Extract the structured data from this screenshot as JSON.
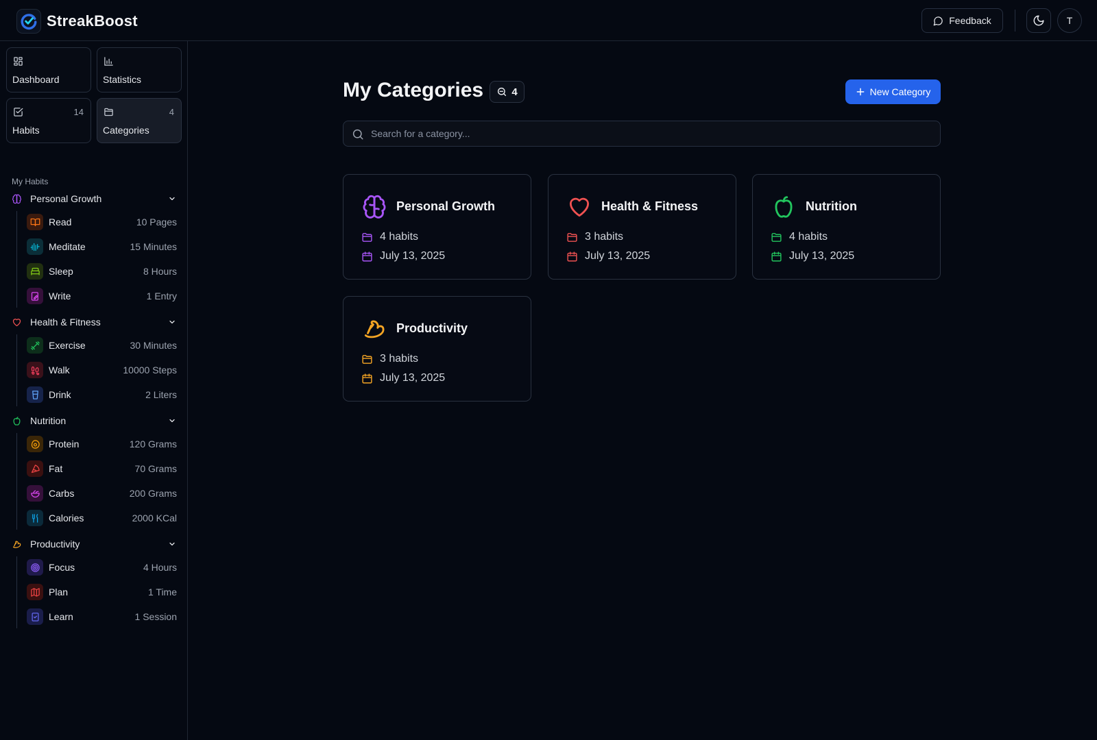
{
  "app": {
    "name": "StreakBoost"
  },
  "header": {
    "feedback_label": "Feedback",
    "avatar_initial": "T"
  },
  "nav": [
    {
      "label": "Dashboard",
      "count": "",
      "icon": "grid-icon"
    },
    {
      "label": "Statistics",
      "count": "",
      "icon": "chart-icon"
    },
    {
      "label": "Habits",
      "count": "14",
      "icon": "check-square-icon"
    },
    {
      "label": "Categories",
      "count": "4",
      "icon": "folder-icon",
      "active": true
    }
  ],
  "sidebar": {
    "section_label": "My Habits",
    "groups": [
      {
        "name": "Personal Growth",
        "color": "#a855f7",
        "icon": "brain-icon",
        "habits": [
          {
            "name": "Read",
            "value": "10 Pages",
            "icon": "book-icon",
            "color": "#f97316"
          },
          {
            "name": "Meditate",
            "value": "15 Minutes",
            "icon": "wave-icon",
            "color": "#06b6d4"
          },
          {
            "name": "Sleep",
            "value": "8 Hours",
            "icon": "bed-icon",
            "color": "#84cc16"
          },
          {
            "name": "Write",
            "value": "1 Entry",
            "icon": "notebook-pen-icon",
            "color": "#d946ef"
          }
        ]
      },
      {
        "name": "Health & Fitness",
        "color": "#f05252",
        "icon": "heart-icon",
        "habits": [
          {
            "name": "Exercise",
            "value": "30 Minutes",
            "icon": "dumbbell-icon",
            "color": "#22c55e"
          },
          {
            "name": "Walk",
            "value": "10000 Steps",
            "icon": "footprints-icon",
            "color": "#f43f5e"
          },
          {
            "name": "Drink",
            "value": "2 Liters",
            "icon": "glass-icon",
            "color": "#60a5fa"
          }
        ]
      },
      {
        "name": "Nutrition",
        "color": "#22c55e",
        "icon": "apple-icon",
        "habits": [
          {
            "name": "Protein",
            "value": "120 Grams",
            "icon": "egg-icon",
            "color": "#f59e0b"
          },
          {
            "name": "Fat",
            "value": "70 Grams",
            "icon": "pizza-icon",
            "color": "#ef4444"
          },
          {
            "name": "Carbs",
            "value": "200 Grams",
            "icon": "salad-icon",
            "color": "#d946ef"
          },
          {
            "name": "Calories",
            "value": "2000 KCal",
            "icon": "utensils-icon",
            "color": "#0ea5e9"
          }
        ]
      },
      {
        "name": "Productivity",
        "color": "#f5a524",
        "icon": "muscle-icon",
        "habits": [
          {
            "name": "Focus",
            "value": "4 Hours",
            "icon": "target-icon",
            "color": "#8b5cf6"
          },
          {
            "name": "Plan",
            "value": "1 Time",
            "icon": "map-icon",
            "color": "#ef4444"
          },
          {
            "name": "Learn",
            "value": "1 Session",
            "icon": "clipboard-check-icon",
            "color": "#6366f1"
          }
        ]
      }
    ]
  },
  "main": {
    "title": "My Categories",
    "count": "4",
    "new_button": "New Category",
    "search_placeholder": "Search for a category...",
    "cards": [
      {
        "name": "Personal Growth",
        "habits": "4 habits",
        "date": "July 13, 2025",
        "color": "#a855f7",
        "icon": "brain-icon"
      },
      {
        "name": "Health & Fitness",
        "habits": "3 habits",
        "date": "July 13, 2025",
        "color": "#f05252",
        "icon": "heart-icon"
      },
      {
        "name": "Nutrition",
        "habits": "4 habits",
        "date": "July 13, 2025",
        "color": "#22c55e",
        "icon": "apple-icon"
      },
      {
        "name": "Productivity",
        "habits": "3 habits",
        "date": "July 13, 2025",
        "color": "#f5a524",
        "icon": "muscle-icon"
      }
    ]
  }
}
